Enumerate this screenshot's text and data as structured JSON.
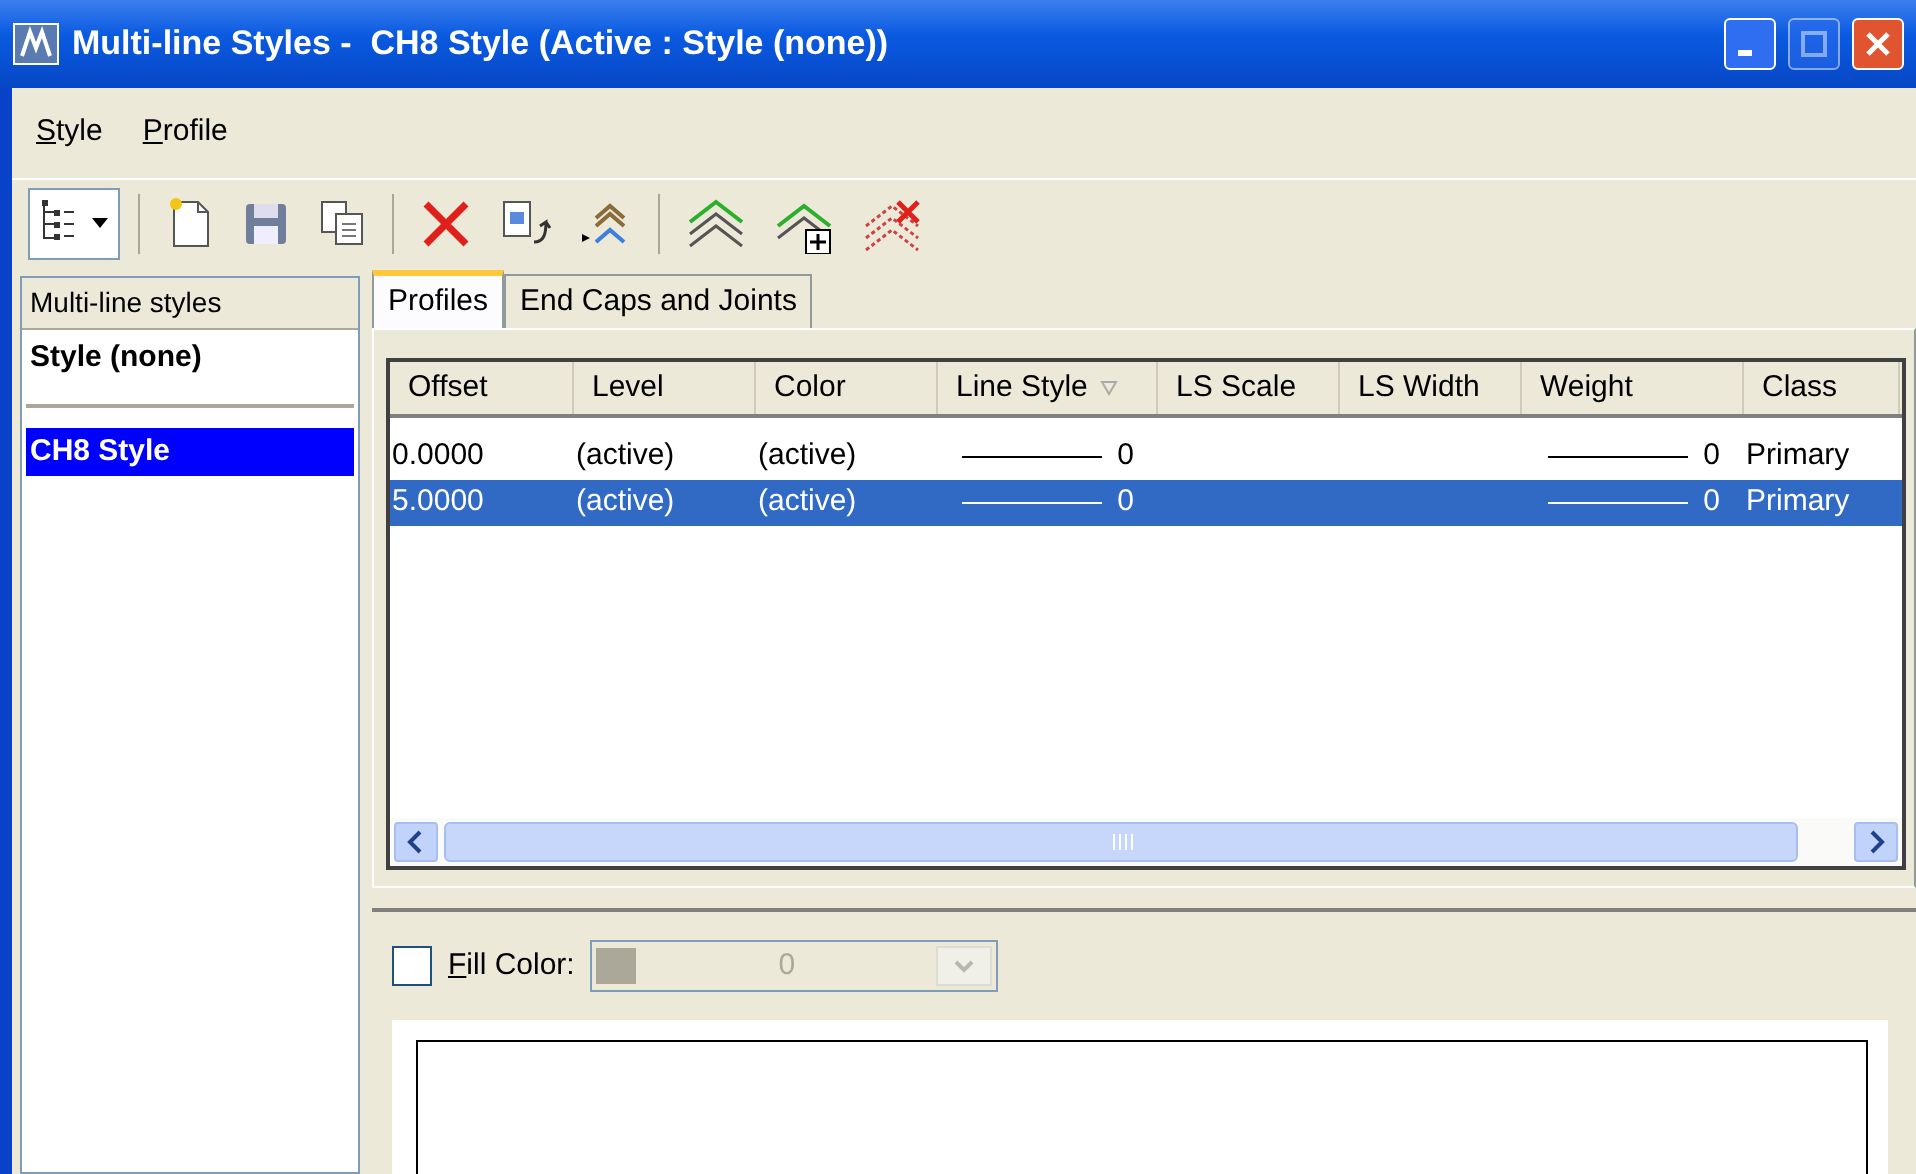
{
  "window": {
    "title": "Multi-line Styles -  CH8 Style (Active : Style (none))"
  },
  "menu": [
    {
      "label": "Style"
    },
    {
      "label": "Profile"
    }
  ],
  "toolbar": [
    {
      "kind": "view"
    },
    {
      "kind": "new"
    },
    {
      "kind": "save"
    },
    {
      "kind": "copy"
    },
    {
      "kind": "delete"
    },
    {
      "kind": "import"
    },
    {
      "kind": "insert"
    },
    {
      "kind": "profile"
    },
    {
      "kind": "profile-add"
    },
    {
      "kind": "profile-delete"
    }
  ],
  "styles_list": {
    "header": "Multi-line styles",
    "items": [
      {
        "label": "Style (none)",
        "kind": "active",
        "selected": false
      },
      {
        "label": "CH8 Style",
        "kind": "style",
        "selected": true
      }
    ]
  },
  "tabs": [
    {
      "label": "Profiles",
      "selected": true
    },
    {
      "label": "End Caps and Joints",
      "selected": false
    }
  ],
  "table": {
    "columns": [
      "Offset",
      "Level",
      "Color",
      "Line Style",
      "LS Scale",
      "LS Width",
      "Weight",
      "Class"
    ],
    "rows": [
      {
        "selected": false,
        "cells": [
          "0.0000",
          "(active)",
          "(active)",
          "0",
          "",
          "",
          "0",
          "Primary"
        ]
      },
      {
        "selected": true,
        "cells": [
          "5.0000",
          "(active)",
          "(active)",
          "0",
          "",
          "",
          "0",
          "Primary"
        ]
      }
    ]
  },
  "fill": {
    "label": "Fill Color:",
    "checked": false,
    "value": "0",
    "disabled": true
  }
}
